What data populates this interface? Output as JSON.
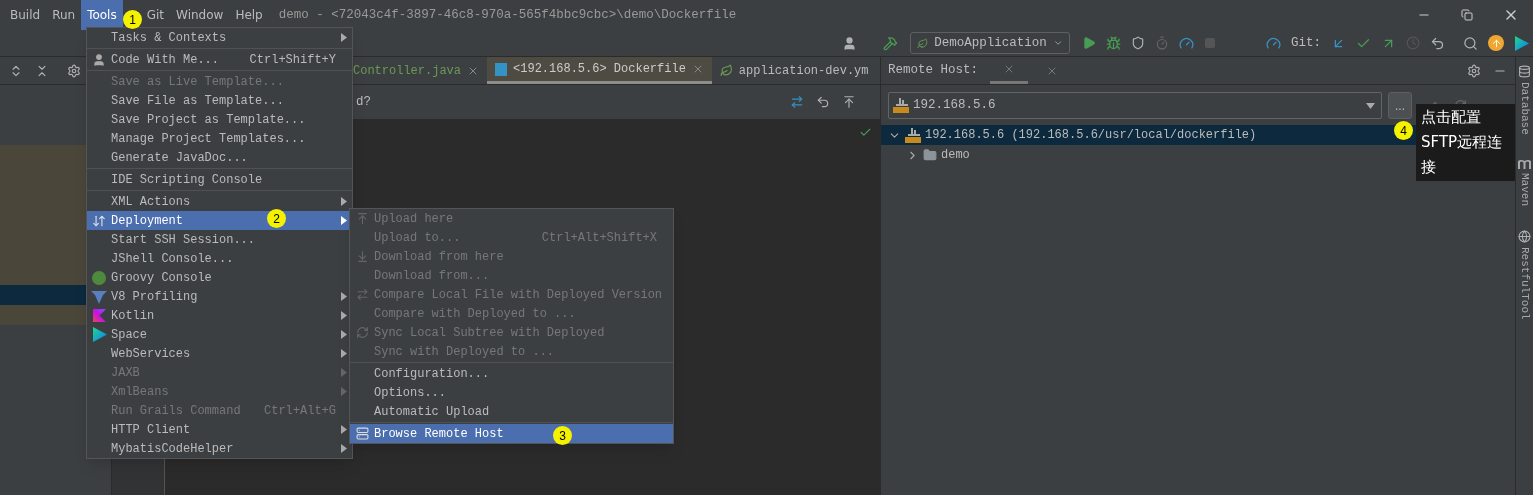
{
  "menu_bar": [
    {
      "label": "Build",
      "selected": false
    },
    {
      "label": "Run",
      "selected": false
    },
    {
      "label": "Tools",
      "selected": true
    },
    {
      "label": "Git",
      "selected": false
    },
    {
      "label": "Window",
      "selected": false
    },
    {
      "label": "Help",
      "selected": false
    }
  ],
  "window_title": "demo - <72043c4f-3897-46c8-970a-565f4bbc9cbc>\\demo\\Dockerfile",
  "toolbar": {
    "run_configuration": "DemoApplication",
    "git_label": "Git:"
  },
  "editor": {
    "tabs": [
      {
        "label": "Controller.java",
        "selected": false
      },
      {
        "label": "<192.168.5.6> Dockerfile",
        "selected": true
      },
      {
        "label": "application-dev.ym",
        "selected": false
      }
    ],
    "banner_text": "d?"
  },
  "tools_menu": [
    {
      "kind": "item",
      "label": "Tasks & Contexts",
      "submenu": true,
      "disabled": false,
      "selected": false
    },
    {
      "kind": "separator"
    },
    {
      "kind": "item",
      "label": "Code With Me...",
      "shortcut": "Ctrl+Shift+Y",
      "submenu": false,
      "disabled": false,
      "selected": false
    },
    {
      "kind": "separator"
    },
    {
      "kind": "item",
      "label": "Save as Live Template...",
      "submenu": false,
      "disabled": true,
      "selected": false
    },
    {
      "kind": "item",
      "label": "Save File as Template...",
      "submenu": false,
      "disabled": false,
      "selected": false
    },
    {
      "kind": "item",
      "label": "Save Project as Template...",
      "submenu": false,
      "disabled": false,
      "selected": false
    },
    {
      "kind": "item",
      "label": "Manage Project Templates...",
      "submenu": false,
      "disabled": false,
      "selected": false
    },
    {
      "kind": "item",
      "label": "Generate JavaDoc...",
      "submenu": false,
      "disabled": false,
      "selected": false
    },
    {
      "kind": "separator"
    },
    {
      "kind": "item",
      "label": "IDE Scripting Console",
      "submenu": false,
      "disabled": false,
      "selected": false
    },
    {
      "kind": "separator"
    },
    {
      "kind": "item",
      "label": "XML Actions",
      "submenu": true,
      "disabled": false,
      "selected": false
    },
    {
      "kind": "item",
      "label": "Deployment",
      "submenu": true,
      "disabled": false,
      "selected": true
    },
    {
      "kind": "item",
      "label": "Start SSH Session...",
      "submenu": false,
      "disabled": false,
      "selected": false
    },
    {
      "kind": "item",
      "label": "JShell Console...",
      "submenu": false,
      "disabled": false,
      "selected": false
    },
    {
      "kind": "item",
      "label": "Groovy Console",
      "submenu": false,
      "disabled": false,
      "selected": false
    },
    {
      "kind": "item",
      "label": "V8 Profiling",
      "submenu": true,
      "disabled": false,
      "selected": false
    },
    {
      "kind": "item",
      "label": "Kotlin",
      "submenu": true,
      "disabled": false,
      "selected": false
    },
    {
      "kind": "item",
      "label": "Space",
      "submenu": true,
      "disabled": false,
      "selected": false
    },
    {
      "kind": "item",
      "label": "WebServices",
      "submenu": true,
      "disabled": false,
      "selected": false
    },
    {
      "kind": "item",
      "label": "JAXB",
      "submenu": true,
      "disabled": true,
      "selected": false
    },
    {
      "kind": "item",
      "label": "XmlBeans",
      "submenu": true,
      "disabled": true,
      "selected": false
    },
    {
      "kind": "item",
      "label": "Run Grails Command",
      "shortcut": "Ctrl+Alt+G",
      "submenu": false,
      "disabled": true,
      "selected": false
    },
    {
      "kind": "item",
      "label": "HTTP Client",
      "submenu": true,
      "disabled": false,
      "selected": false
    },
    {
      "kind": "item",
      "label": "MybatisCodeHelper",
      "submenu": true,
      "disabled": false,
      "selected": false
    }
  ],
  "deployment_submenu": [
    {
      "kind": "item",
      "label": "Upload here",
      "submenu": false,
      "disabled": true,
      "selected": false
    },
    {
      "kind": "item",
      "label": "Upload to...",
      "shortcut": "Ctrl+Alt+Shift+X",
      "submenu": false,
      "disabled": true,
      "selected": false
    },
    {
      "kind": "item",
      "label": "Download from here",
      "submenu": false,
      "disabled": true,
      "selected": false
    },
    {
      "kind": "item",
      "label": "Download from...",
      "submenu": false,
      "disabled": true,
      "selected": false
    },
    {
      "kind": "item",
      "label": "Compare Local File with Deployed Version",
      "submenu": false,
      "disabled": true,
      "selected": false
    },
    {
      "kind": "item",
      "label": "Compare with Deployed to ...",
      "submenu": false,
      "disabled": true,
      "selected": false
    },
    {
      "kind": "item",
      "label": "Sync Local Subtree with Deployed",
      "submenu": false,
      "disabled": true,
      "selected": false
    },
    {
      "kind": "item",
      "label": "Sync with Deployed to ...",
      "submenu": false,
      "disabled": true,
      "selected": false
    },
    {
      "kind": "separator"
    },
    {
      "kind": "item",
      "label": "Configuration...",
      "submenu": false,
      "disabled": false,
      "selected": false
    },
    {
      "kind": "item",
      "label": "Options...",
      "submenu": false,
      "disabled": false,
      "selected": false
    },
    {
      "kind": "item",
      "label": "Automatic Upload",
      "submenu": false,
      "disabled": false,
      "selected": false
    },
    {
      "kind": "separator"
    },
    {
      "kind": "item",
      "label": "Browse Remote Host",
      "submenu": false,
      "disabled": false,
      "selected": true
    }
  ],
  "remote_host_panel": {
    "title": "Remote Host:",
    "host_selector": "192.168.5.6",
    "browse_button": "...",
    "tree": [
      {
        "label": "192.168.5.6 (192.168.5.6/usr/local/dockerfile)",
        "expanded": true,
        "selected": true,
        "children": [
          {
            "label": "demo",
            "expanded": false,
            "selected": false
          }
        ]
      }
    ]
  },
  "tooltip": "点击配置SFTP远程连接",
  "right_strip": [
    "Database",
    "Maven",
    "RestfulTool"
  ],
  "step_markers": [
    "1",
    "2",
    "3",
    "4"
  ]
}
